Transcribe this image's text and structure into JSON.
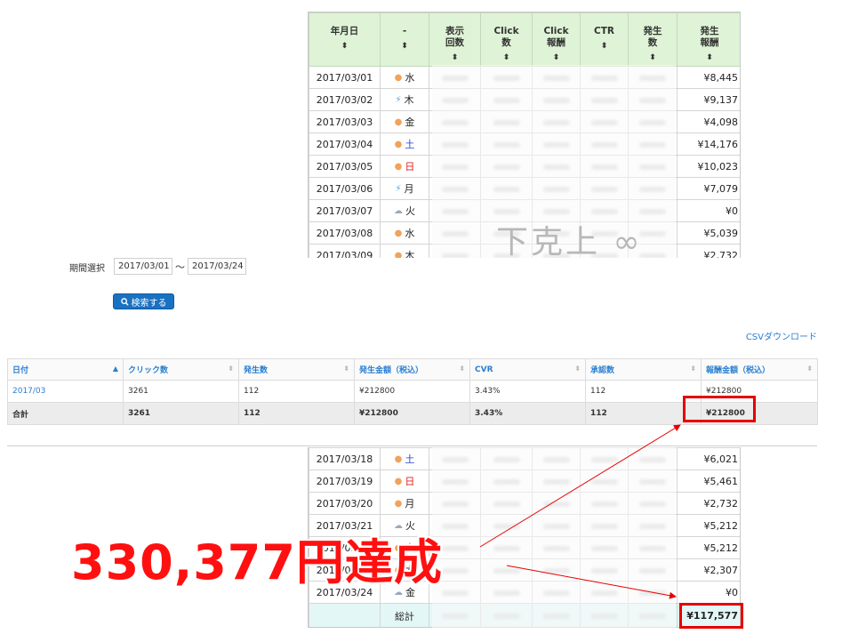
{
  "daily_table": {
    "headers": [
      "年月日",
      "-",
      "表示\n回数",
      "Click\n数",
      "Click\n報酬",
      "CTR",
      "発生\n数",
      "発生\n報酬"
    ],
    "sort_glyph": "⬍",
    "rows_top": [
      {
        "date": "2017/03/01",
        "weather": "sun",
        "weekday": "水",
        "reward": "¥8,445"
      },
      {
        "date": "2017/03/02",
        "weather": "rain",
        "weekday": "木",
        "reward": "¥9,137"
      },
      {
        "date": "2017/03/03",
        "weather": "sun",
        "weekday": "金",
        "reward": "¥4,098"
      },
      {
        "date": "2017/03/04",
        "weather": "sun",
        "weekday": "土",
        "reward": "¥14,176"
      },
      {
        "date": "2017/03/05",
        "weather": "sun",
        "weekday": "日",
        "reward": "¥10,023"
      },
      {
        "date": "2017/03/06",
        "weather": "rain",
        "weekday": "月",
        "reward": "¥7,079"
      },
      {
        "date": "2017/03/07",
        "weather": "cloud",
        "weekday": "火",
        "reward": "¥0"
      },
      {
        "date": "2017/03/08",
        "weather": "sun",
        "weekday": "水",
        "reward": "¥5,039"
      },
      {
        "date": "2017/03/09",
        "weather": "sun",
        "weekday": "木",
        "reward": "¥2,732"
      }
    ],
    "rows_bottom": [
      {
        "date": "2017/03/18",
        "weather": "sun",
        "weekday": "土",
        "reward": "¥6,021"
      },
      {
        "date": "2017/03/19",
        "weather": "sun",
        "weekday": "日",
        "reward": "¥5,461"
      },
      {
        "date": "2017/03/20",
        "weather": "sun",
        "weekday": "月",
        "reward": "¥2,732"
      },
      {
        "date": "2017/03/21",
        "weather": "cloud",
        "weekday": "火",
        "reward": "¥5,212"
      },
      {
        "date": "2017/03/22",
        "weather": "sun",
        "weekday": "水",
        "reward": "¥5,212"
      },
      {
        "date": "2017/03/23",
        "weather": "sun",
        "weekday": "木",
        "reward": "¥2,307"
      },
      {
        "date": "2017/03/24",
        "weather": "cloud",
        "weekday": "金",
        "reward": "¥0"
      }
    ],
    "total_label": "総計",
    "total_reward": "¥117,577"
  },
  "watermark": "下克上 ∞",
  "filter": {
    "period_label": "期間選択",
    "start_date": "2017/03/01",
    "tilde": "〜",
    "end_date": "2017/03/24",
    "search_label": "検索する"
  },
  "csv_download": "CSVダウンロード",
  "summary_table": {
    "headers": [
      "日付",
      "クリック数",
      "発生数",
      "発生金額（税込）",
      "CVR",
      "承認数",
      "報酬金額（税込）"
    ],
    "rows": [
      {
        "date": "2017/03",
        "clicks": "3261",
        "occurrences": "112",
        "amount": "¥212800",
        "cvr": "3.43%",
        "approved": "112",
        "reward": "¥212800"
      }
    ],
    "total": {
      "label": "合計",
      "clicks": "3261",
      "occurrences": "112",
      "amount": "¥212800",
      "cvr": "3.43%",
      "approved": "112",
      "reward": "¥212800"
    }
  },
  "headline": "330,377円達成",
  "colors": {
    "accent_red": "#e60000",
    "link_blue": "#2a7fd0",
    "header_green": "#dff3d6",
    "button_blue": "#1971c2"
  }
}
